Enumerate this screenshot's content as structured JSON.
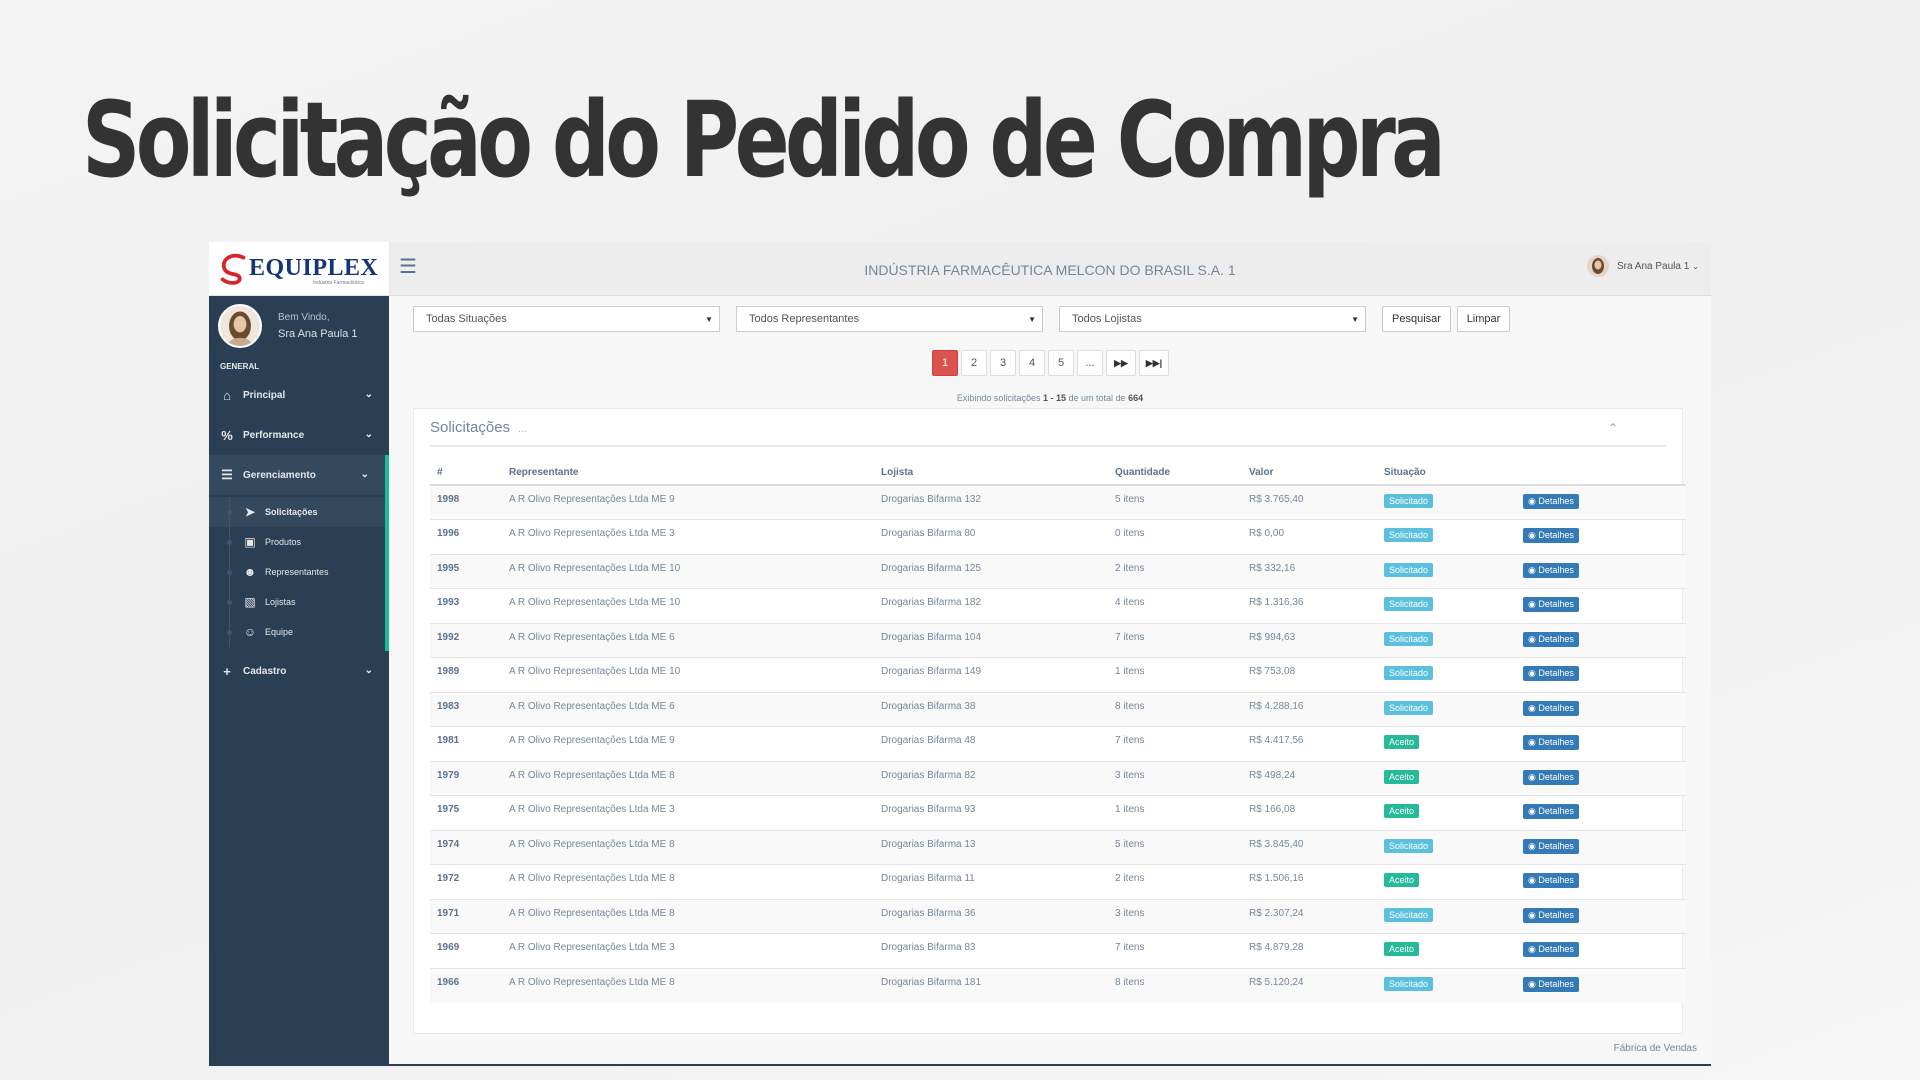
{
  "slide": {
    "title": "Solicitação do Pedido de Compra"
  },
  "brand": {
    "name": "EQUIPLEX",
    "subtitle": "Indústria Farmacêutica"
  },
  "sidebar": {
    "welcome": "Bem Vindo,",
    "user": "Sra Ana Paula 1",
    "section": "GENERAL",
    "items": [
      {
        "label": "Principal",
        "icon": "home-icon"
      },
      {
        "label": "Performance",
        "icon": "percent-icon"
      },
      {
        "label": "Gerenciamento",
        "icon": "list-icon"
      },
      {
        "label": "Cadastro",
        "icon": "plus-icon"
      }
    ],
    "subitems": [
      {
        "label": "Solicitações",
        "icon": "send-icon"
      },
      {
        "label": "Produtos",
        "icon": "gift-icon"
      },
      {
        "label": "Representantes",
        "icon": "user-circle-icon"
      },
      {
        "label": "Lojistas",
        "icon": "book-icon"
      },
      {
        "label": "Equipe",
        "icon": "users-icon"
      }
    ]
  },
  "header": {
    "company": "INDÚSTRIA FARMACÊUTICA MELCON DO BRASIL S.A. 1",
    "user": "Sra Ana Paula 1"
  },
  "filters": {
    "situacao": "Todas Situações",
    "representante": "Todos Representantes",
    "lojista": "Todos Lojistas",
    "search_label": "Pesquisar",
    "clear_label": "Limpar"
  },
  "pagination": {
    "pages": [
      "1",
      "2",
      "3",
      "4",
      "5",
      "..."
    ],
    "current": 1
  },
  "summary": {
    "prefix": "Exibindo solicitações",
    "range": "1 - 15",
    "middle": "de um total de",
    "total": "664"
  },
  "panel": {
    "title": "Solicitações",
    "dots": "..."
  },
  "table": {
    "headers": [
      "#",
      "Representante",
      "Lojista",
      "Quantidade",
      "Valor",
      "Situação",
      ""
    ],
    "detail_label": "Detalhes",
    "rows": [
      {
        "id": "1998",
        "rep": "A R Olivo Representações Ltda ME 9",
        "loj": "Drogarias Bifarma 132",
        "qtd": "5 itens",
        "valor": "R$ 3.765,40",
        "sit": "Solicitado"
      },
      {
        "id": "1996",
        "rep": "A R Olivo Representações Ltda ME 3",
        "loj": "Drogarias Bifarma 80",
        "qtd": "0 itens",
        "valor": "R$ 0,00",
        "sit": "Solicitado"
      },
      {
        "id": "1995",
        "rep": "A R Olivo Representações Ltda ME 10",
        "loj": "Drogarias Bifarma 125",
        "qtd": "2 itens",
        "valor": "R$ 332,16",
        "sit": "Solicitado"
      },
      {
        "id": "1993",
        "rep": "A R Olivo Representações Ltda ME 10",
        "loj": "Drogarias Bifarma 182",
        "qtd": "4 itens",
        "valor": "R$ 1.316,36",
        "sit": "Solicitado"
      },
      {
        "id": "1992",
        "rep": "A R Olivo Representações Ltda ME 6",
        "loj": "Drogarias Bifarma 104",
        "qtd": "7 itens",
        "valor": "R$ 994,63",
        "sit": "Solicitado"
      },
      {
        "id": "1989",
        "rep": "A R Olivo Representações Ltda ME 10",
        "loj": "Drogarias Bifarma 149",
        "qtd": "1 itens",
        "valor": "R$ 753,08",
        "sit": "Solicitado"
      },
      {
        "id": "1983",
        "rep": "A R Olivo Representações Ltda ME 6",
        "loj": "Drogarias Bifarma 38",
        "qtd": "8 itens",
        "valor": "R$ 4.288,16",
        "sit": "Solicitado"
      },
      {
        "id": "1981",
        "rep": "A R Olivo Representações Ltda ME 9",
        "loj": "Drogarias Bifarma 48",
        "qtd": "7 itens",
        "valor": "R$ 4.417,56",
        "sit": "Aceito"
      },
      {
        "id": "1979",
        "rep": "A R Olivo Representações Ltda ME 8",
        "loj": "Drogarias Bifarma 82",
        "qtd": "3 itens",
        "valor": "R$ 498,24",
        "sit": "Aceito"
      },
      {
        "id": "1975",
        "rep": "A R Olivo Representações Ltda ME 3",
        "loj": "Drogarias Bifarma 93",
        "qtd": "1 itens",
        "valor": "R$ 166,08",
        "sit": "Aceito"
      },
      {
        "id": "1974",
        "rep": "A R Olivo Representações Ltda ME 8",
        "loj": "Drogarias Bifarma 13",
        "qtd": "5 itens",
        "valor": "R$ 3.845,40",
        "sit": "Solicitado"
      },
      {
        "id": "1972",
        "rep": "A R Olivo Representações Ltda ME 8",
        "loj": "Drogarias Bifarma 11",
        "qtd": "2 itens",
        "valor": "R$ 1.506,16",
        "sit": "Aceito"
      },
      {
        "id": "1971",
        "rep": "A R Olivo Representações Ltda ME 8",
        "loj": "Drogarias Bifarma 36",
        "qtd": "3 itens",
        "valor": "R$ 2.307,24",
        "sit": "Solicitado"
      },
      {
        "id": "1969",
        "rep": "A R Olivo Representações Ltda ME 3",
        "loj": "Drogarias Bifarma 83",
        "qtd": "7 itens",
        "valor": "R$ 4.879,28",
        "sit": "Aceito"
      },
      {
        "id": "1966",
        "rep": "A R Olivo Representações Ltda ME 8",
        "loj": "Drogarias Bifarma 181",
        "qtd": "8 itens",
        "valor": "R$ 5.120,24",
        "sit": "Solicitado"
      }
    ]
  },
  "footer": {
    "text": "Fábrica de Vendas"
  },
  "colors": {
    "sidebar": "#2a3f54",
    "accent": "#1abb9c",
    "danger": "#d9534f",
    "info": "#5bc0de",
    "success": "#26b99a",
    "primary": "#337ab7"
  }
}
